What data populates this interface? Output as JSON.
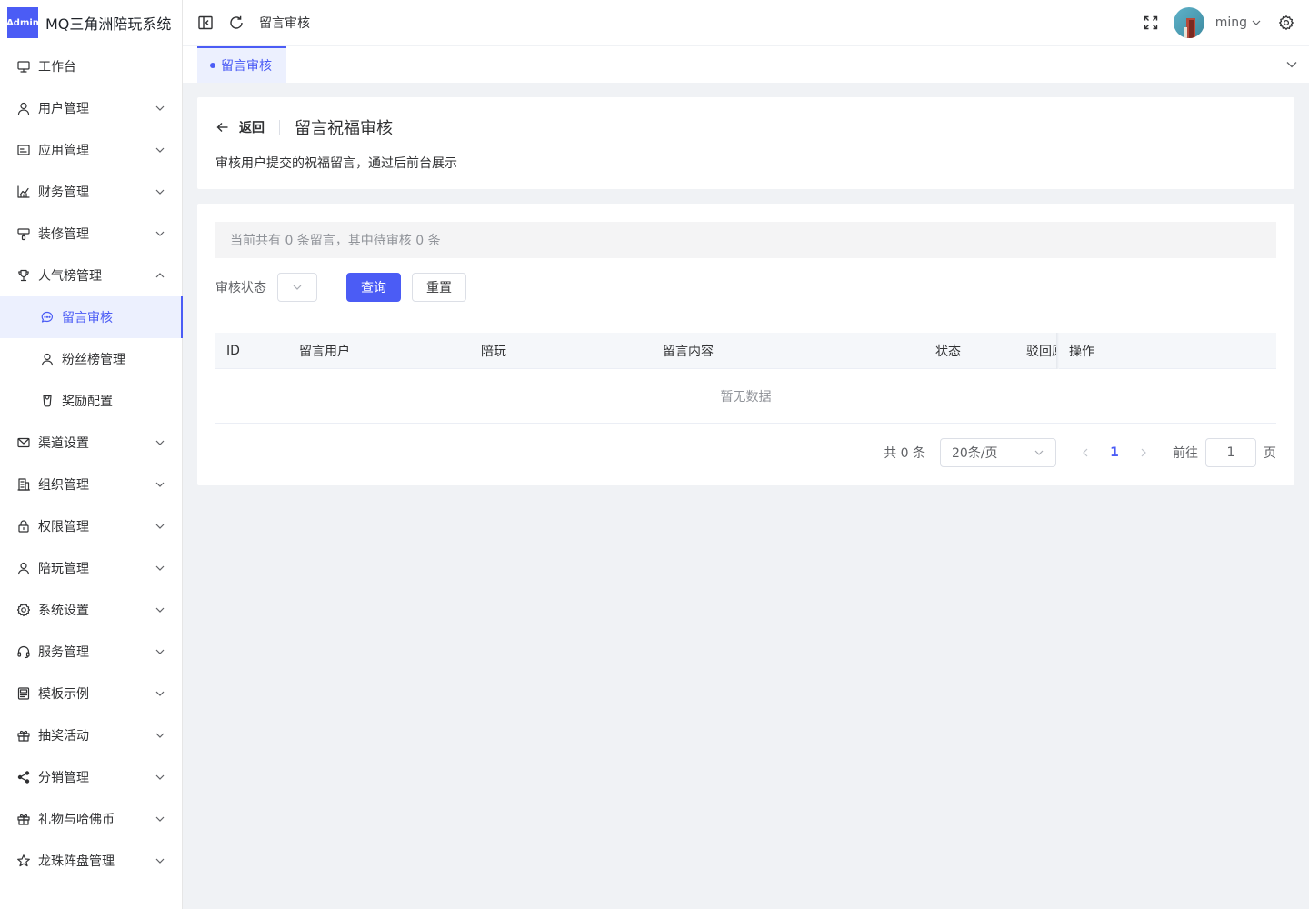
{
  "app": {
    "logo_badge": "Admin",
    "title": "MQ三角洲陪玩系统"
  },
  "sidebar": {
    "items": [
      {
        "label": "工作台",
        "icon": "monitor-icon",
        "has_arrow": false
      },
      {
        "label": "用户管理",
        "icon": "user-icon",
        "has_arrow": true
      },
      {
        "label": "应用管理",
        "icon": "app-card-icon",
        "has_arrow": true
      },
      {
        "label": "财务管理",
        "icon": "chart-icon",
        "has_arrow": true
      },
      {
        "label": "装修管理",
        "icon": "paint-brush-icon",
        "has_arrow": true
      },
      {
        "label": "人气榜管理",
        "icon": "trophy-icon",
        "has_arrow": true,
        "expanded": true
      },
      {
        "label": "留言审核",
        "icon": "chat-bubble-icon",
        "sub": true,
        "active": true
      },
      {
        "label": "粉丝榜管理",
        "icon": "user-icon",
        "sub": true
      },
      {
        "label": "奖励配置",
        "icon": "mug-icon",
        "sub": true
      },
      {
        "label": "渠道设置",
        "icon": "mail-icon",
        "has_arrow": true
      },
      {
        "label": "组织管理",
        "icon": "building-icon",
        "has_arrow": true
      },
      {
        "label": "权限管理",
        "icon": "lock-icon",
        "has_arrow": true
      },
      {
        "label": "陪玩管理",
        "icon": "user-icon",
        "has_arrow": true
      },
      {
        "label": "系统设置",
        "icon": "gear-icon",
        "has_arrow": true
      },
      {
        "label": "服务管理",
        "icon": "headset-icon",
        "has_arrow": true
      },
      {
        "label": "模板示例",
        "icon": "template-icon",
        "has_arrow": true
      },
      {
        "label": "抽奖活动",
        "icon": "gift-icon",
        "has_arrow": true
      },
      {
        "label": "分销管理",
        "icon": "share-icon",
        "has_arrow": true
      },
      {
        "label": "礼物与哈佛币",
        "icon": "gift-icon",
        "has_arrow": true
      },
      {
        "label": "龙珠阵盘管理",
        "icon": "star-icon",
        "has_arrow": true
      }
    ]
  },
  "header": {
    "breadcrumb": "留言审核",
    "username": "ming"
  },
  "tabs": [
    {
      "label": "留言审核",
      "active": true
    }
  ],
  "page": {
    "back_label": "返回",
    "title": "留言祝福审核",
    "description": "审核用户提交的祝福留言，通过后前台展示"
  },
  "summary": {
    "text": "当前共有 0 条留言，其中待审核 0 条"
  },
  "filter": {
    "status_label": "审核状态",
    "search_button": "查询",
    "reset_button": "重置"
  },
  "table": {
    "columns": [
      "ID",
      "留言用户",
      "陪玩",
      "留言内容",
      "状态",
      "驳回原因",
      "操作"
    ],
    "empty_text": "暂无数据"
  },
  "pagination": {
    "total_text": "共 0 条",
    "page_size": "20条/页",
    "current_page": "1",
    "jump_label": "前往",
    "jump_value": "1",
    "jump_suffix": "页"
  },
  "colors": {
    "accent": "#4b5cf5",
    "accent_light": "#ecf0fe"
  }
}
